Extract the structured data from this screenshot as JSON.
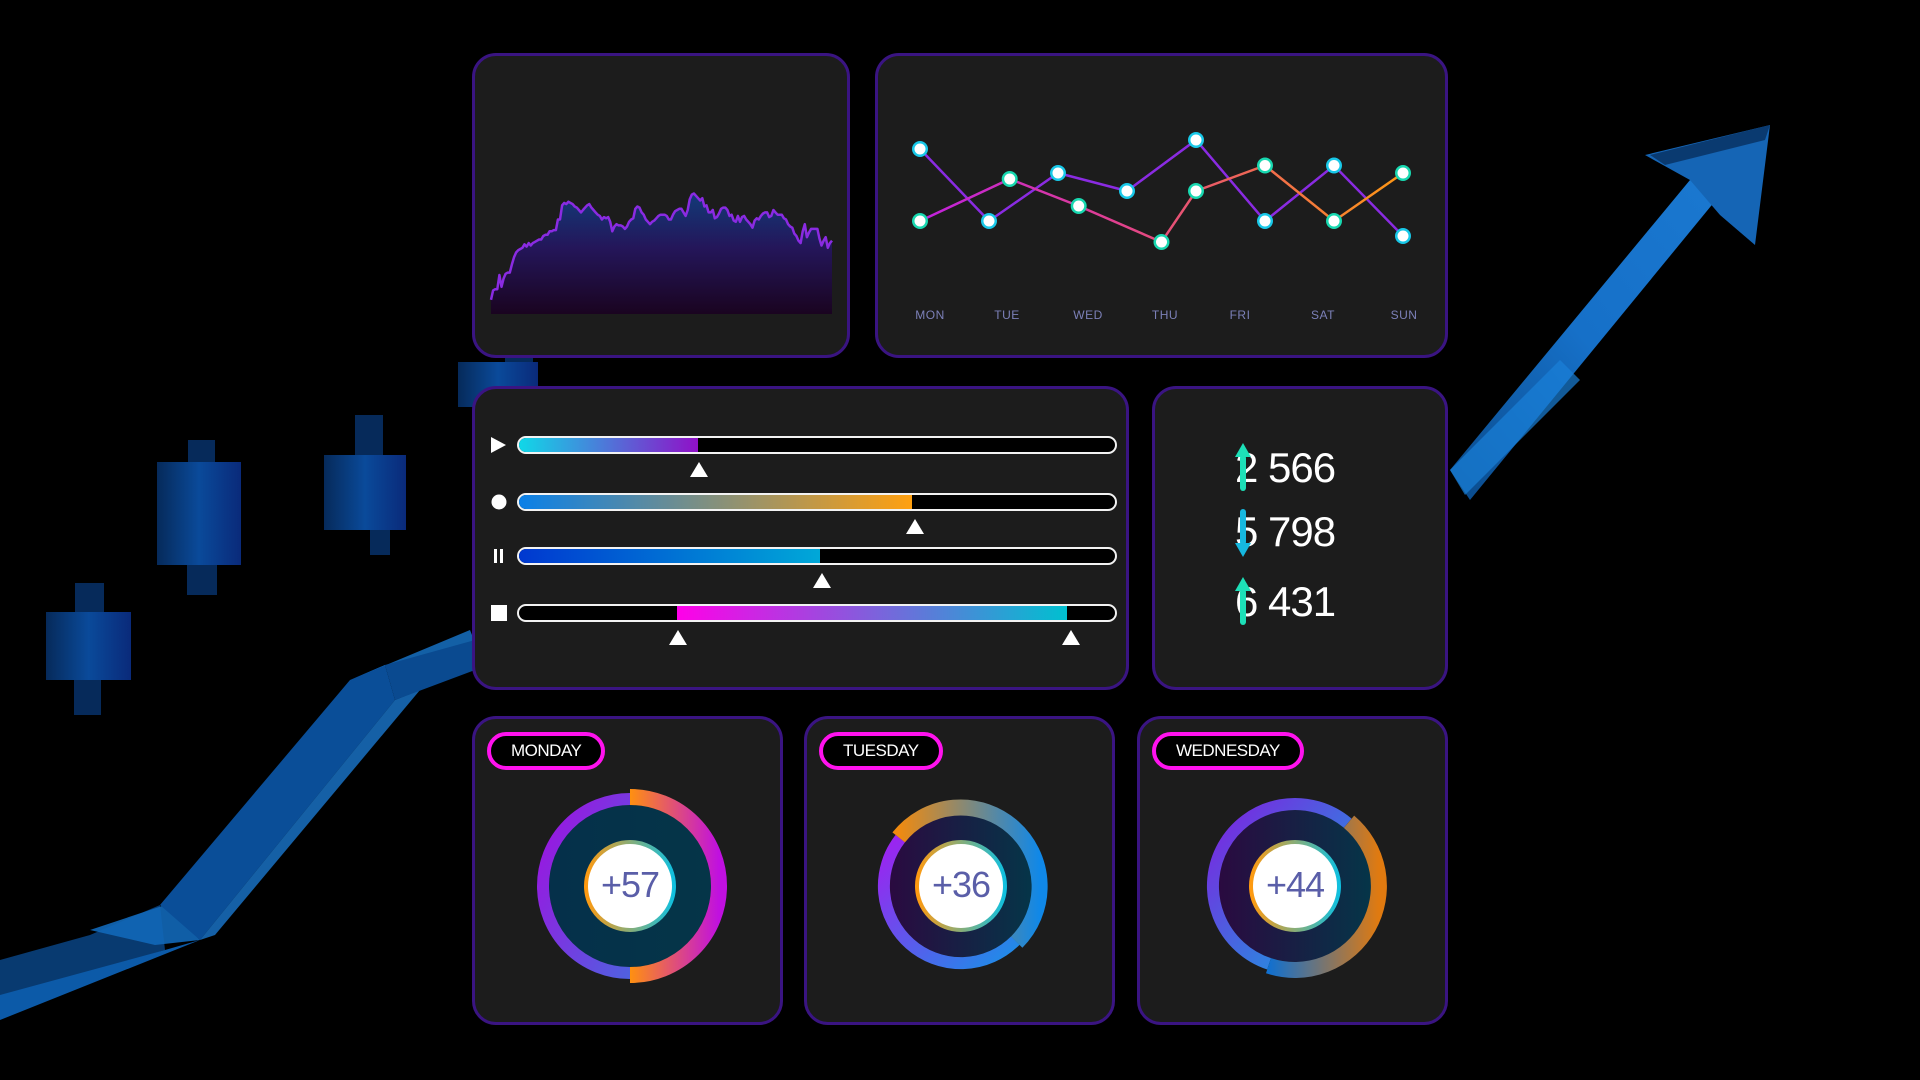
{
  "area_panel": {
    "series_color": "#8a2be2",
    "chart_data": {
      "type": "area",
      "values": [
        12,
        20,
        21,
        21,
        33,
        23,
        30,
        34,
        35,
        35,
        42,
        48,
        52,
        54,
        55,
        56,
        59,
        57,
        60,
        58,
        60,
        61,
        62,
        63,
        63,
        66,
        67,
        67,
        70,
        70,
        71,
        71,
        80,
        80,
        92,
        94,
        93,
        95,
        94,
        93,
        91,
        90,
        88,
        86,
        88,
        90,
        92,
        93,
        90,
        88,
        86,
        84,
        83,
        80,
        82,
        81,
        82,
        78,
        70,
        74,
        76,
        75,
        75,
        74,
        72,
        74,
        78,
        80,
        81,
        89,
        91,
        90,
        86,
        84,
        80,
        78,
        76,
        78,
        79,
        81,
        83,
        84,
        84,
        84,
        83,
        80,
        80,
        84,
        87,
        88,
        89,
        89,
        86,
        83,
        88,
        97,
        101,
        102,
        100,
        98,
        96,
        98,
        91,
        92,
        86,
        86,
        88,
        81,
        82,
        85,
        89,
        90,
        90,
        88,
        83,
        84,
        79,
        78,
        83,
        78,
        82,
        83,
        80,
        78,
        76,
        73,
        79,
        81,
        80,
        83,
        85,
        86,
        86,
        82,
        83,
        88,
        86,
        84,
        84,
        84,
        81,
        80,
        76,
        74,
        73,
        68,
        66,
        62,
        60,
        70,
        76,
        65,
        69,
        72,
        72,
        72,
        72,
        64,
        58,
        62,
        65,
        56,
        60,
        62
      ],
      "ylim": [
        0,
        110
      ]
    }
  },
  "line_panel": {
    "chart_data": {
      "type": "line",
      "categories": [
        "MON",
        "TUE",
        "WED",
        "THU",
        "FRI",
        "SAT",
        "SUN"
      ],
      "series": [
        {
          "name": "series-purple",
          "color": "#8a2be2",
          "dot_ring": "#18c8e8",
          "x": [
            0,
            1,
            2,
            3,
            4,
            5,
            6,
            7
          ],
          "values": [
            78,
            30,
            62,
            50,
            84,
            30,
            67,
            20
          ]
        },
        {
          "name": "series-gradient",
          "colors": [
            "#c020e0",
            "#e04080",
            "#f07050",
            "#ff9010"
          ],
          "dot_ring": "#18d8b0",
          "x": [
            0,
            1.3,
            2.3,
            3.5,
            4,
            5,
            6,
            7
          ],
          "values": [
            30,
            58,
            40,
            16,
            50,
            67,
            30,
            62
          ]
        }
      ],
      "ylim": [
        0,
        100
      ],
      "xlabel": "",
      "ylabel": ""
    }
  },
  "sliders": [
    {
      "icon": "play-icon",
      "type": "single",
      "value": 0.3,
      "gradient": [
        "#10d8e8",
        "#9010c8"
      ]
    },
    {
      "icon": "record-icon",
      "type": "single",
      "value": 0.66,
      "gradient": [
        "#0a80e8",
        "#ffa010"
      ]
    },
    {
      "icon": "pause-icon",
      "type": "single",
      "value": 0.505,
      "gradient": [
        "#0038d0",
        "#00a8d8"
      ]
    },
    {
      "icon": "stop-icon",
      "type": "range",
      "low": 0.265,
      "high": 0.92,
      "gradient": [
        "#ff00e8",
        "#00c0d0"
      ]
    }
  ],
  "stats": [
    {
      "direction": "up",
      "value": "2 566",
      "color": "#1de0b8"
    },
    {
      "direction": "down",
      "value": "5 798",
      "color": "#16b8e0"
    },
    {
      "direction": "up",
      "value": "6 431",
      "color": "#1de0b8"
    }
  ],
  "days": [
    {
      "label": "MONDAY",
      "value_text": "+57",
      "highlight_fraction": 0.5
    },
    {
      "label": "TUESDAY",
      "value_text": "+36",
      "highlight_fraction": 0.52
    },
    {
      "label": "WEDNESDAY",
      "value_text": "+44",
      "highlight_fraction": 0.44
    }
  ]
}
